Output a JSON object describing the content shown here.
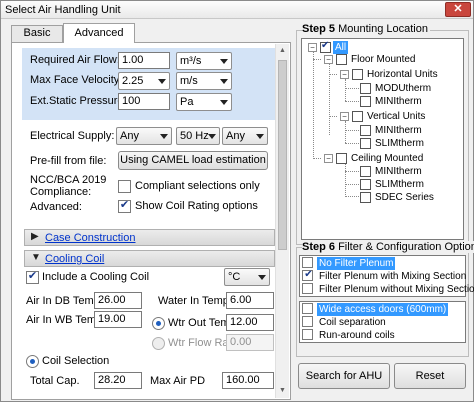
{
  "window": {
    "title": "Select Air Handling Unit",
    "close_label": "✕"
  },
  "tabs": [
    {
      "label": "Basic"
    },
    {
      "label": "Advanced"
    }
  ],
  "design": {
    "airflow": {
      "label": "Required Air Flow:",
      "value": "1.00",
      "unit": "m³/s"
    },
    "face_velocity": {
      "label": "Max Face Velocity:",
      "value": "2.25",
      "unit": "m/s"
    },
    "static_pressure": {
      "label": "Ext.Static Pressure:",
      "value": "100",
      "unit": "Pa"
    }
  },
  "electrical": {
    "label": "Electrical Supply:",
    "phase": "Any",
    "frequency": "50 Hz",
    "voltage": "Any"
  },
  "prefill": {
    "label": "Pre-fill from file:",
    "button": "Using CAMEL load estimation"
  },
  "compliance": {
    "label_line1": "NCC/BCA 2019",
    "label_line2": "Compliance:",
    "option": "Compliant selections only",
    "checked": false
  },
  "advanced": {
    "label": "Advanced:",
    "option": "Show Coil Rating options",
    "checked": true
  },
  "case_construction": {
    "label": "Case Construction",
    "arrow": "▶"
  },
  "cooling_coil": {
    "label": "Cooling Coil",
    "arrow": "▼",
    "include_label": "Include a Cooling Coil",
    "include_checked": true,
    "temp_unit": "°C",
    "air_in_db": {
      "label": "Air In DB Temp",
      "value": "26.00"
    },
    "air_in_wb": {
      "label": "Air In WB Temp",
      "value": "19.00"
    },
    "water_in": {
      "label": "Water In Temp",
      "value": "6.00"
    },
    "wtr_out": {
      "label": "Wtr Out Temp",
      "value": "12.00",
      "selected": true
    },
    "wtr_flow": {
      "label": "Wtr Flow Rate",
      "value": "0.00",
      "selected": false
    },
    "coil_selection": {
      "label": "Coil Selection",
      "selected": true
    },
    "total_cap": {
      "label": "Total Cap.",
      "value": "28.20"
    },
    "max_air_pd": {
      "label": "Max Air PD",
      "value": "160.00"
    }
  },
  "step5": {
    "step": "Step 5",
    "title": "Mounting Location",
    "tree": [
      {
        "label": "All",
        "checked": true,
        "selected": true
      },
      {
        "label": "Floor Mounted",
        "checked": false
      },
      {
        "label": "Horizontal Units",
        "checked": false
      },
      {
        "label": "MODUtherm",
        "checked": false
      },
      {
        "label": "MINItherm",
        "checked": false
      },
      {
        "label": "Vertical Units",
        "checked": false
      },
      {
        "label": "MINItherm",
        "checked": false
      },
      {
        "label": "SLIMtherm",
        "checked": false
      },
      {
        "label": "Ceiling Mounted",
        "checked": false
      },
      {
        "label": "MINItherm",
        "checked": false
      },
      {
        "label": "SLIMtherm",
        "checked": false
      },
      {
        "label": "SDEC Series",
        "checked": false
      }
    ]
  },
  "step6": {
    "step": "Step 6",
    "title": "Filter & Configuration Options",
    "filters": [
      {
        "label": "No Filter Plenum",
        "checked": false,
        "selected": true
      },
      {
        "label": "Filter Plenum with Mixing Section",
        "checked": true,
        "selected": false
      },
      {
        "label": "Filter Plenum without Mixing Section",
        "checked": false,
        "selected": false
      }
    ],
    "options": [
      {
        "label": "Wide access doors (600mm)",
        "checked": false,
        "selected": true
      },
      {
        "label": "Coil separation",
        "checked": false,
        "selected": false
      },
      {
        "label": "Run-around coils",
        "checked": false,
        "selected": false
      }
    ]
  },
  "actions": {
    "search": "Search for AHU",
    "reset": "Reset"
  }
}
